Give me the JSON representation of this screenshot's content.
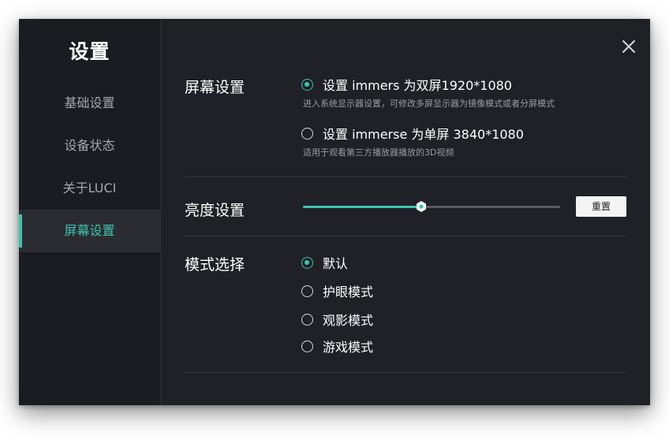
{
  "sidebar": {
    "title": "设置",
    "items": [
      {
        "label": "基础设置",
        "active": false
      },
      {
        "label": "设备状态",
        "active": false
      },
      {
        "label": "关于LUCI",
        "active": false
      },
      {
        "label": "屏幕设置",
        "active": true
      }
    ]
  },
  "icons": {
    "close": "close-icon",
    "slider_thumb": "hexagon-handle-icon"
  },
  "colors": {
    "accent": "#3ec2ad",
    "window_bg": "#202127",
    "sidebar_bg": "#1b1c21"
  },
  "screen": {
    "label": "屏幕设置",
    "options": [
      {
        "label": "设置 immers 为双屏1920*1080",
        "desc": "进入系统显示器设置，可修改多屏显示器为镜像模式或者分屏模式",
        "checked": true
      },
      {
        "label": "设置 immerse 为单屏 3840*1080",
        "desc": "适用于观看第三方播放器播放的3D视频",
        "checked": false
      }
    ]
  },
  "brightness": {
    "label": "亮度设置",
    "level": 0.46,
    "reset_label": "重置"
  },
  "mode": {
    "label": "模式选择",
    "options": [
      {
        "label": "默认",
        "checked": true
      },
      {
        "label": "护眼模式",
        "checked": false
      },
      {
        "label": "观影模式",
        "checked": false
      },
      {
        "label": "游戏模式",
        "checked": false
      }
    ]
  }
}
